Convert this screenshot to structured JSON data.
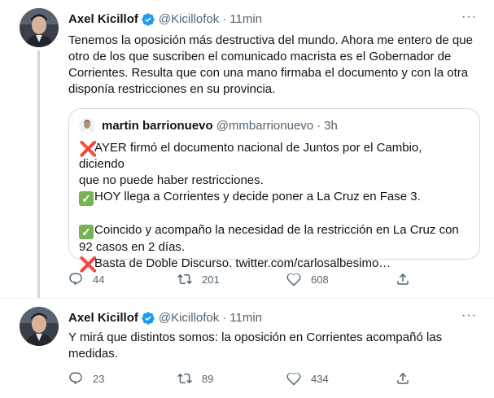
{
  "tweet1": {
    "author_name": "Axel Kicillof",
    "author_handle": "@Kicillofok",
    "separator": "·",
    "time": "11min",
    "more_label": "···",
    "text_lines": [
      "Tenemos la oposición más destructiva del mundo. Ahora me entero de que",
      "otro de los que suscriben el comunicado macrista es el Gobernador de",
      "Corrientes. Resulta que con una mano firmaba el documento y con la otra",
      "disponía restricciones en su provincia."
    ],
    "quote": {
      "author_name": "martin barrionuevo",
      "author_handle": "@mmbarrionuevo",
      "time": "3h",
      "lines": [
        "AYER firmó el documento nacional de Juntos por el Cambio, diciendo",
        "que no puede haber restricciones.",
        "HOY llega a Corrientes y decide poner a La Cruz en Fase 3.",
        "Coincido y acompaño la necesidad de la restricción en La Cruz con",
        "92 casos en 2 días.",
        "Basta de Doble Discurso. twitter.com/carlosalbesimo…"
      ],
      "emoji": {
        "cross": "❌",
        "check": "✓"
      }
    },
    "replies": "44",
    "retweets": "201",
    "likes": "608"
  },
  "tweet2": {
    "author_name": "Axel Kicillof",
    "author_handle": "@Kicillofok",
    "separator": "·",
    "time": "11min",
    "more_label": "···",
    "text_lines": [
      "Y mirá que distintos somos: la oposición en Corrientes acompañó las",
      "medidas."
    ],
    "replies": "23",
    "retweets": "89",
    "likes": "434"
  },
  "colors": {
    "verified": "#1d9bf0",
    "secondary_text": "#536471",
    "border": "#cfd9de"
  },
  "icons": [
    "verified-badge-icon",
    "more-icon",
    "reply-icon",
    "retweet-icon",
    "like-icon",
    "share-icon"
  ]
}
